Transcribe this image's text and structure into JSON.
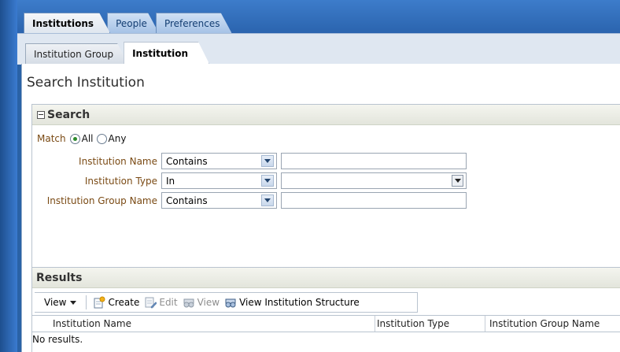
{
  "tabs_level1": [
    {
      "label": "Institutions",
      "active": true
    },
    {
      "label": "People",
      "active": false
    },
    {
      "label": "Preferences",
      "active": false
    }
  ],
  "tabs_level2": [
    {
      "label": "Institution Group",
      "active": false
    },
    {
      "label": "Institution",
      "active": true
    }
  ],
  "page": {
    "title": "Search Institution"
  },
  "search": {
    "title": "Search",
    "match_label": "Match",
    "match_all": "All",
    "match_any": "Any",
    "match_selected": "All",
    "criteria": [
      {
        "label": "Institution Name",
        "operator": "Contains",
        "value": ""
      },
      {
        "label": "Institution Type",
        "operator": "In",
        "value": ""
      },
      {
        "label": "Institution Group Name",
        "operator": "Contains",
        "value": ""
      }
    ]
  },
  "results": {
    "title": "Results",
    "toolbar": {
      "view": "View",
      "create": "Create",
      "edit": "Edit",
      "view_btn": "View",
      "view_structure": "View Institution Structure"
    },
    "columns": [
      "Institution Name",
      "Institution Type",
      "Institution Group Name"
    ],
    "empty_text": "No results."
  },
  "colors": {
    "frame_blue": "#2a62a6",
    "label_brown": "#7a4a14",
    "radio_green": "#2c8a2c"
  }
}
